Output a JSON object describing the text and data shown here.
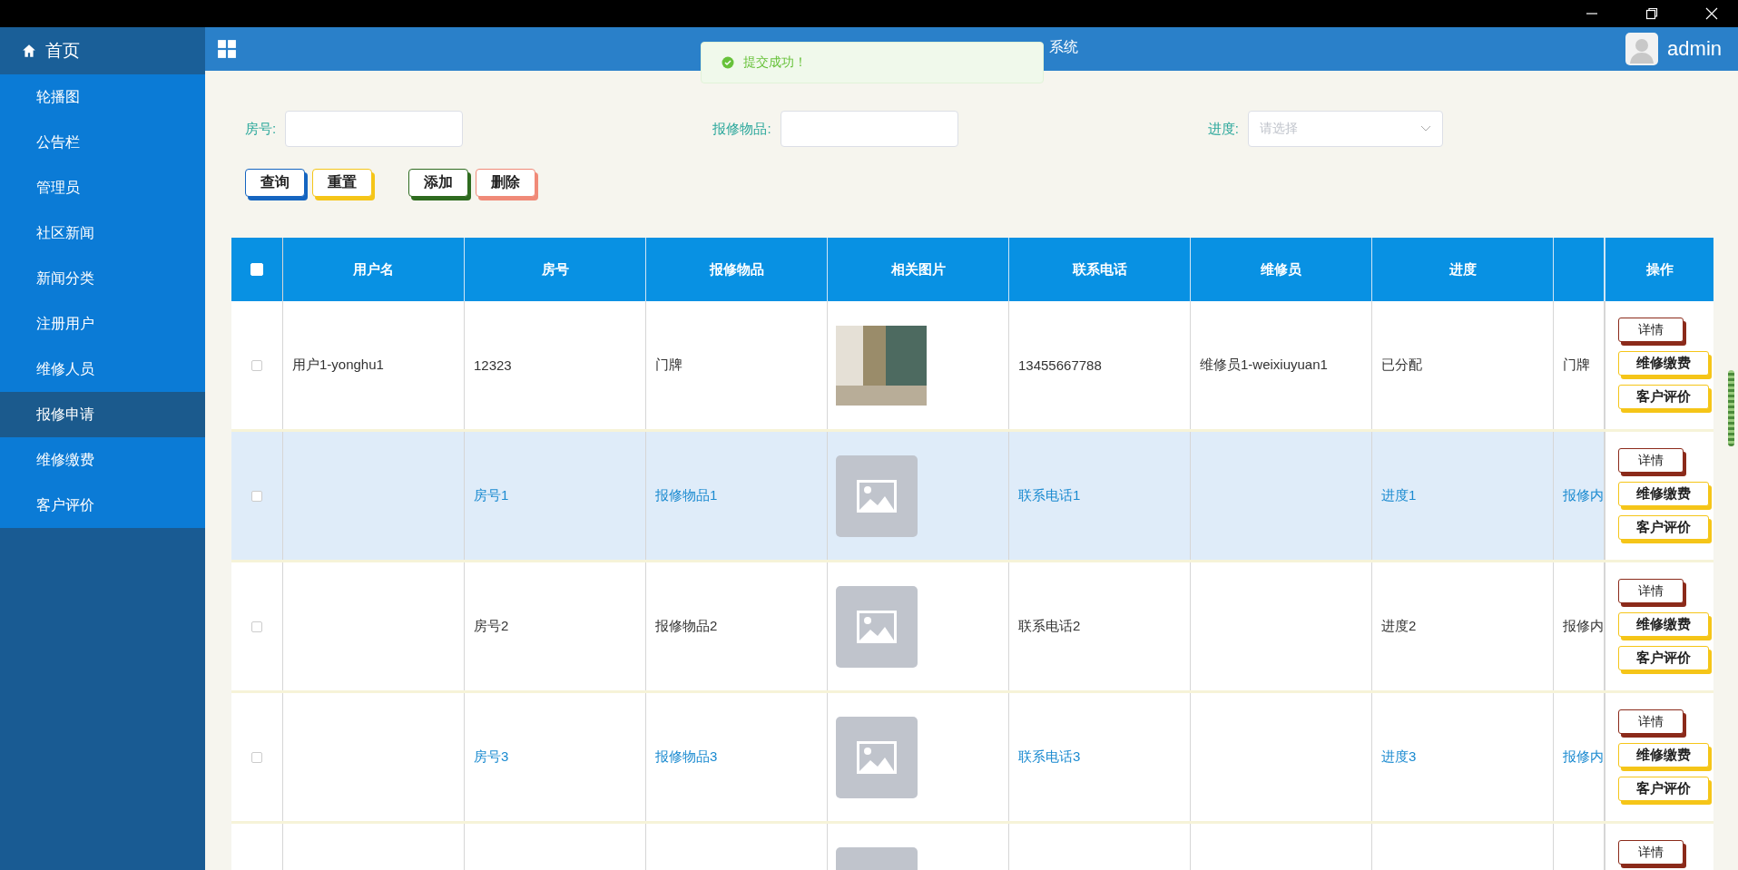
{
  "sidebar": {
    "home": {
      "label": "首页"
    },
    "items": [
      {
        "label": "轮播图",
        "selected": false
      },
      {
        "label": "公告栏",
        "selected": false
      },
      {
        "label": "管理员",
        "selected": false
      },
      {
        "label": "社区新闻",
        "selected": false
      },
      {
        "label": "新闻分类",
        "selected": false
      },
      {
        "label": "注册用户",
        "selected": false
      },
      {
        "label": "维修人员",
        "selected": false
      },
      {
        "label": "报修申请",
        "selected": true
      },
      {
        "label": "维修缴费",
        "selected": false
      },
      {
        "label": "客户评价",
        "selected": false
      }
    ]
  },
  "header": {
    "title": "系统",
    "user": "admin"
  },
  "toast": {
    "message": "提交成功！"
  },
  "filters": [
    {
      "label": "房号:",
      "kind": "input"
    },
    {
      "label": "报修物品:",
      "kind": "input"
    },
    {
      "label": "进度:",
      "kind": "select",
      "placeholder": "请选择"
    }
  ],
  "buttons": [
    {
      "label": "查询",
      "color": "#1565c0"
    },
    {
      "label": "重置",
      "color": "#f5c518"
    },
    {
      "label": "添加",
      "color": "#2e6b1f"
    },
    {
      "label": "删除",
      "color": "#f08a78"
    }
  ],
  "table": {
    "header_checkbox": {
      "checked": false
    },
    "columns": [
      "用户名",
      "房号",
      "报修物品",
      "相关图片",
      "联系电话",
      "维修员",
      "进度",
      "",
      "操作"
    ],
    "rows": [
      {
        "checked": false,
        "hovered": false,
        "link_style": false,
        "cells": [
          "用户1-yonghu1",
          "12323",
          "门牌",
          "",
          "13455667788",
          "维修员1-weixiuyuan1",
          "已分配",
          "门牌"
        ],
        "image": {
          "kind": "photo"
        },
        "actions": [
          {
            "label": "详情",
            "color": "#8b2a1a"
          },
          {
            "label": "维修缴费",
            "color": "#f5c518"
          },
          {
            "label": "客户评价",
            "color": "#f5c518"
          }
        ]
      },
      {
        "checked": false,
        "hovered": true,
        "link_style": true,
        "cells": [
          "",
          "房号1",
          "报修物品1",
          "",
          "联系电话1",
          "",
          "进度1",
          "报修内"
        ],
        "image": {
          "kind": "placeholder"
        },
        "actions": [
          {
            "label": "详情",
            "color": "#8b2a1a"
          },
          {
            "label": "维修缴费",
            "color": "#f5c518"
          },
          {
            "label": "客户评价",
            "color": "#f5c518"
          }
        ]
      },
      {
        "checked": false,
        "hovered": false,
        "link_style": false,
        "cells": [
          "",
          "房号2",
          "报修物品2",
          "",
          "联系电话2",
          "",
          "进度2",
          "报修内"
        ],
        "image": {
          "kind": "placeholder"
        },
        "actions": [
          {
            "label": "详情",
            "color": "#8b2a1a"
          },
          {
            "label": "维修缴费",
            "color": "#f5c518"
          },
          {
            "label": "客户评价",
            "color": "#f5c518"
          }
        ]
      },
      {
        "checked": false,
        "hovered": false,
        "link_style": true,
        "cells": [
          "",
          "房号3",
          "报修物品3",
          "",
          "联系电话3",
          "",
          "进度3",
          "报修内"
        ],
        "image": {
          "kind": "placeholder"
        },
        "actions": [
          {
            "label": "详情",
            "color": "#8b2a1a"
          },
          {
            "label": "维修缴费",
            "color": "#f5c518"
          },
          {
            "label": "客户评价",
            "color": "#f5c518"
          }
        ]
      },
      {
        "hovered": false,
        "cells": [
          "",
          "",
          "",
          "",
          "",
          "",
          "",
          ""
        ],
        "image": {
          "kind": "placeholder"
        },
        "actions": [
          {
            "label": "详情",
            "color": "#8b2a1a"
          }
        ]
      }
    ]
  }
}
